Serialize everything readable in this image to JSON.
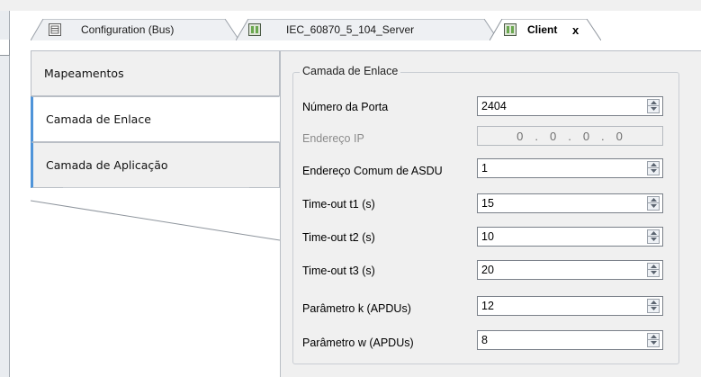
{
  "tabs": [
    {
      "label": "Configuration (Bus)",
      "active": false
    },
    {
      "label": "IEC_60870_5_104_Server",
      "active": false
    },
    {
      "label": "Client",
      "active": true
    }
  ],
  "close_glyph": "x",
  "nav": {
    "items": [
      {
        "label": "Mapeamentos"
      },
      {
        "label": "Camada de Enlace"
      },
      {
        "label": "Camada de Aplicação"
      }
    ],
    "selected": "Camada de Enlace"
  },
  "group": {
    "title": "Camada de Enlace",
    "fields": [
      {
        "label": "Número da Porta",
        "value": "2404"
      },
      {
        "label": "Endereço IP",
        "disabled": true,
        "ip": [
          "0",
          ".",
          "0",
          ".",
          "0",
          ".",
          "0"
        ]
      },
      {
        "label": "Endereço Comum de ASDU",
        "value": "1"
      },
      {
        "label": "Time-out t1 (s)",
        "value": "15"
      },
      {
        "label": "Time-out t2 (s)",
        "value": "10"
      },
      {
        "label": "Time-out t3 (s)",
        "value": "20"
      },
      {
        "label": "Parâmetro k (APDUs)",
        "value": "12"
      },
      {
        "label": "Parâmetro w (APDUs)",
        "value": "8"
      }
    ]
  },
  "colors": {
    "accent": "#4f94d9",
    "panel_bg": "#f0f0f0",
    "border": "#b9bec5"
  },
  "icons": [
    "bus-config-icon",
    "device-icon",
    "device-icon"
  ]
}
